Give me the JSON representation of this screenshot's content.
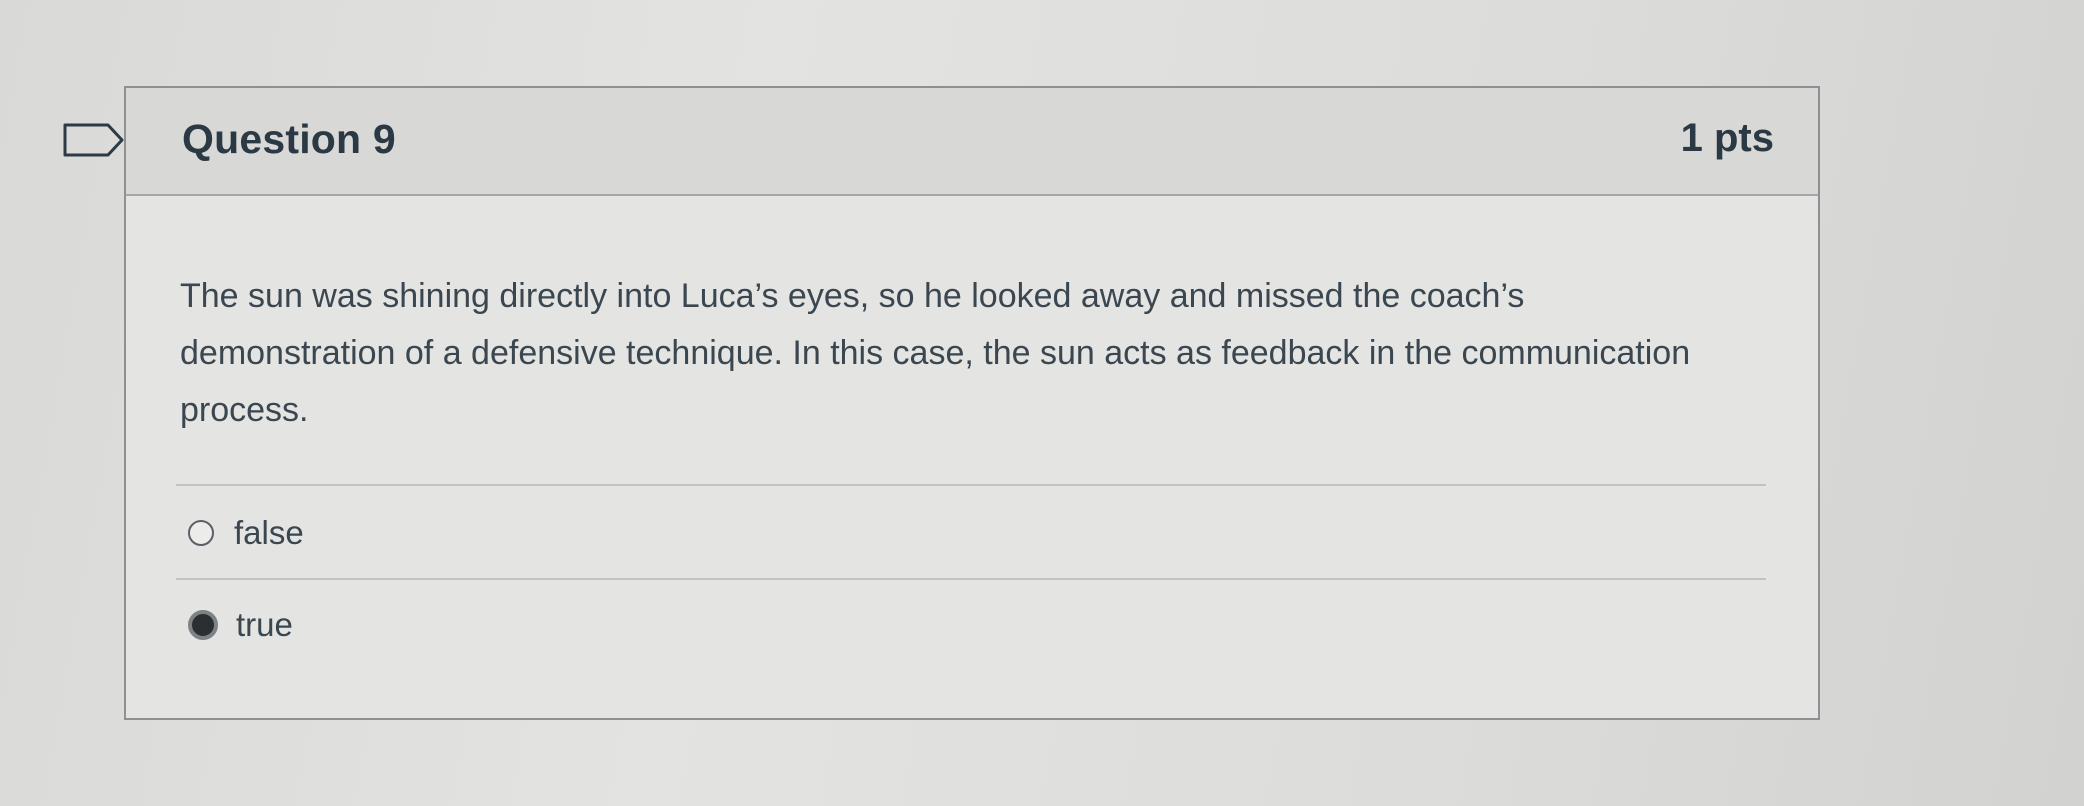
{
  "question": {
    "title": "Question 9",
    "points": "1 pts",
    "text": "The sun was shining directly into Luca’s eyes, so he looked away and missed the coach’s demonstration of a defensive technique. In this case, the sun acts as feedback in the communication process.",
    "answers": [
      {
        "label": "false",
        "selected": false
      },
      {
        "label": "true",
        "selected": true
      }
    ]
  },
  "icons": {
    "flag": "flag-icon"
  }
}
